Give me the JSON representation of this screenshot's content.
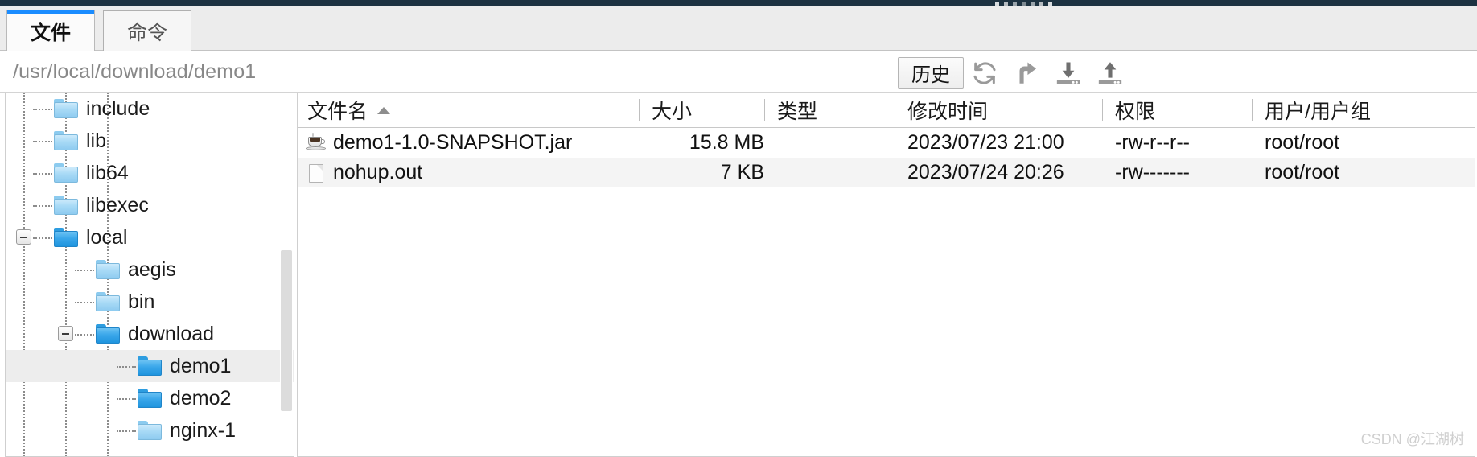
{
  "window": {
    "accent_color": "#1a8cff",
    "titlebar_color": "#1d3241"
  },
  "tabs": [
    {
      "label": "文件",
      "active": true
    },
    {
      "label": "命令",
      "active": false
    }
  ],
  "pathbar": {
    "value": "/usr/local/download/demo1",
    "placeholder": "/usr/local/download/demo1",
    "history_label": "历史",
    "icons": [
      {
        "name": "refresh-icon",
        "title": "refresh"
      },
      {
        "name": "parent-directory-icon",
        "title": "up"
      },
      {
        "name": "download-icon",
        "title": "download"
      },
      {
        "name": "upload-icon",
        "title": "upload"
      }
    ]
  },
  "tree": {
    "items": [
      {
        "label": "include",
        "depth": 2,
        "expandable": false,
        "expanded": false,
        "selected": false,
        "icon": "folder-light"
      },
      {
        "label": "lib",
        "depth": 2,
        "expandable": false,
        "expanded": false,
        "selected": false,
        "icon": "folder-light"
      },
      {
        "label": "lib64",
        "depth": 2,
        "expandable": false,
        "expanded": false,
        "selected": false,
        "icon": "folder-light"
      },
      {
        "label": "libexec",
        "depth": 2,
        "expandable": false,
        "expanded": false,
        "selected": false,
        "icon": "folder-light"
      },
      {
        "label": "local",
        "depth": 2,
        "expandable": true,
        "expanded": true,
        "selected": false,
        "icon": "folder-dark"
      },
      {
        "label": "aegis",
        "depth": 3,
        "expandable": false,
        "expanded": false,
        "selected": false,
        "icon": "folder-light"
      },
      {
        "label": "bin",
        "depth": 3,
        "expandable": false,
        "expanded": false,
        "selected": false,
        "icon": "folder-light"
      },
      {
        "label": "download",
        "depth": 3,
        "expandable": true,
        "expanded": true,
        "selected": false,
        "icon": "folder-dark"
      },
      {
        "label": "demo1",
        "depth": 4,
        "expandable": false,
        "expanded": false,
        "selected": true,
        "icon": "folder-dark"
      },
      {
        "label": "demo2",
        "depth": 4,
        "expandable": false,
        "expanded": false,
        "selected": false,
        "icon": "folder-dark"
      },
      {
        "label": "nginx-1",
        "depth": 4,
        "expandable": false,
        "expanded": false,
        "selected": false,
        "icon": "folder-light"
      }
    ]
  },
  "filelist": {
    "columns": [
      {
        "label": "文件名",
        "sorted": true,
        "sort_dir": "asc"
      },
      {
        "label": "大小",
        "sorted": false,
        "sort_dir": ""
      },
      {
        "label": "类型",
        "sorted": false,
        "sort_dir": ""
      },
      {
        "label": "修改时间",
        "sorted": false,
        "sort_dir": ""
      },
      {
        "label": "权限",
        "sorted": false,
        "sort_dir": ""
      },
      {
        "label": "用户/用户组",
        "sorted": false,
        "sort_dir": ""
      }
    ],
    "rows": [
      {
        "icon": "jar-file-icon",
        "name": "demo1-1.0-SNAPSHOT.jar",
        "size": "15.8 MB",
        "type": "",
        "modified": "2023/07/23 21:00",
        "permissions": "-rw-r--r--",
        "owner": "root/root"
      },
      {
        "icon": "text-file-icon",
        "name": "nohup.out",
        "size": "7 KB",
        "type": "",
        "modified": "2023/07/24 20:26",
        "permissions": "-rw-------",
        "owner": "root/root"
      }
    ]
  },
  "watermark": {
    "text": "CSDN @江湖树"
  }
}
